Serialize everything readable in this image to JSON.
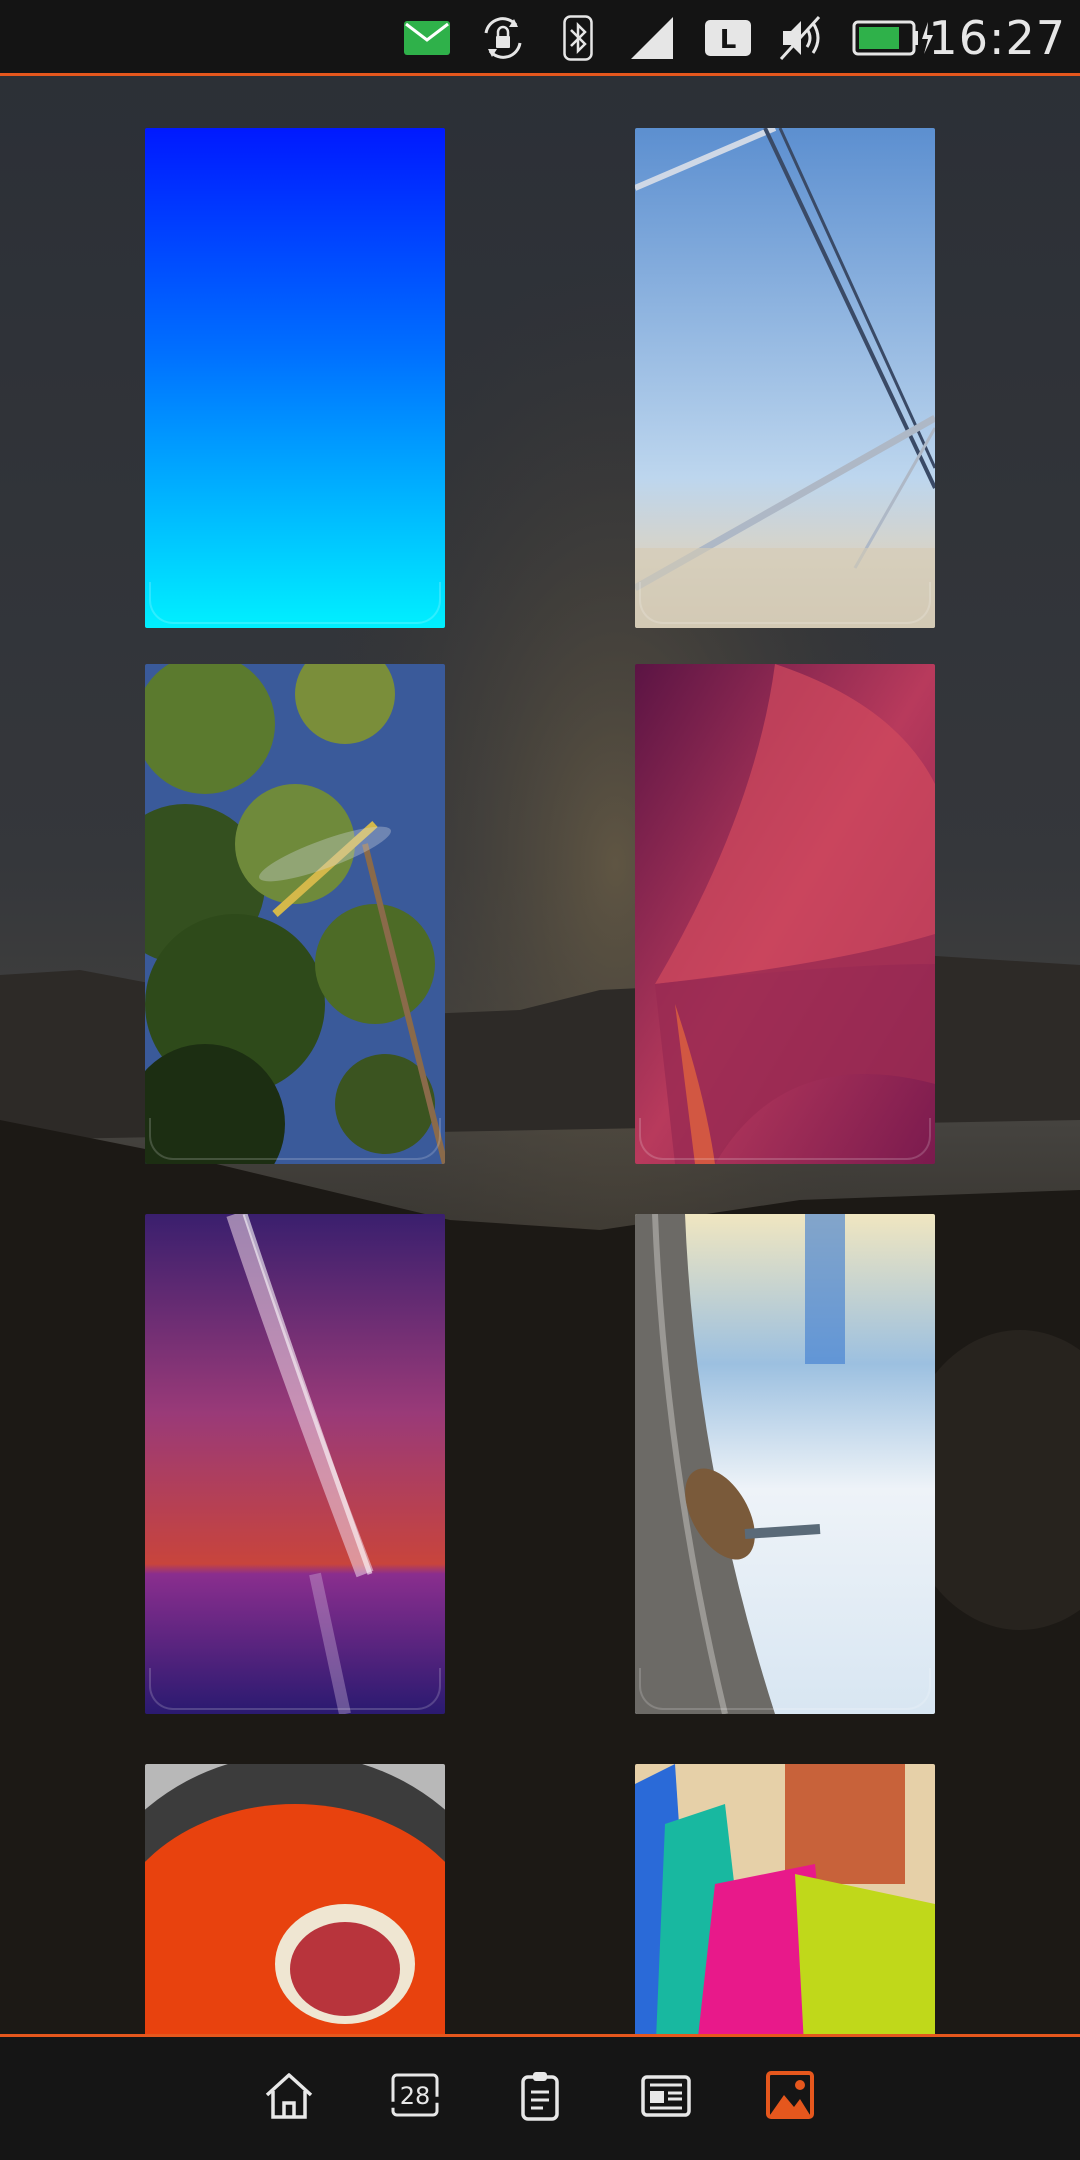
{
  "status_bar": {
    "time": "16:27",
    "icons": [
      "mail-icon",
      "screen-rotation-lock-icon",
      "bluetooth-icon",
      "cell-signal-icon",
      "lte-icon",
      "mute-icon",
      "battery-charging-icon"
    ],
    "lte_label": "L",
    "accent_color": "#e5571d"
  },
  "gallery": {
    "thumbnails": [
      {
        "name": "wallpaper-blue-gradient"
      },
      {
        "name": "wallpaper-sky-cables"
      },
      {
        "name": "wallpaper-dragonfly-leaves"
      },
      {
        "name": "wallpaper-magenta-abstract"
      },
      {
        "name": "wallpaper-milky-way"
      },
      {
        "name": "wallpaper-nuthatch-bird"
      },
      {
        "name": "wallpaper-fig-plate"
      },
      {
        "name": "wallpaper-colored-threads"
      }
    ]
  },
  "nav_bar": {
    "items": [
      {
        "icon": "home-icon"
      },
      {
        "icon": "calendar-icon",
        "label": "28"
      },
      {
        "icon": "clipboard-icon"
      },
      {
        "icon": "news-icon"
      },
      {
        "icon": "gallery-icon",
        "active": true
      }
    ],
    "active_color": "#e5571d"
  }
}
